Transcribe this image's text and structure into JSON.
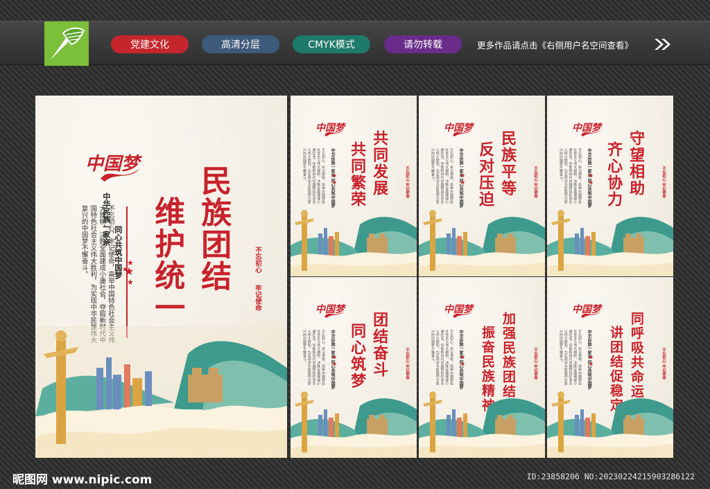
{
  "toolbar": {
    "tags": [
      {
        "label": "党建文化",
        "color": "#c5262d"
      },
      {
        "label": "高清分层",
        "color": "#3d5a7a"
      },
      {
        "label": "CMYK模式",
        "color": "#1f7a6c"
      },
      {
        "label": "请勿转载",
        "color": "#6a2c8a"
      }
    ],
    "note": "更多作品请点击《右侧用户名空间查看》",
    "logo_icon": "pen-nib-icon",
    "arrow_icon": "double-chevron-right-icon"
  },
  "main_board": {
    "brand": "中国梦",
    "title_line1": "民族团结",
    "title_line2": "维护统一",
    "subtitle_a": "中华民族一家亲",
    "subtitle_b": "同心共筑中国梦",
    "body_text": "不忘初心，牢记使命，高举中国特色社会主义伟大旗帜，决胜全面建成小康社会，夺取新时代中国特色社会主义伟大胜利，为实现中华民族伟大复兴的中国梦不懈奋斗。",
    "stamp_a": "不忘初心",
    "stamp_b": "牢记使命"
  },
  "small_boards": [
    {
      "title_a": "共同发展",
      "title_b": "共同繁荣"
    },
    {
      "title_a": "民族平等",
      "title_b": "反对压迫"
    },
    {
      "title_a": "守望相助",
      "title_b": "齐心协力"
    },
    {
      "title_a": "团结奋斗",
      "title_b": "同心筑梦"
    },
    {
      "title_a": "加强民族团结",
      "title_b": "振奋民族精神"
    },
    {
      "title_a": "同呼吸共命运",
      "title_b": "讲团结促稳定"
    }
  ],
  "small_common": {
    "brand": "中国梦",
    "subtitle": "中华民族一家亲 同心共筑中国梦",
    "stamp": "不忘初心 牢记使命"
  },
  "footer": {
    "site": "昵图网 www.nipic.com",
    "id_text": "ID:23858206 NO:20230224215903286122"
  },
  "colors": {
    "accent_red": "#c8232c",
    "paper": "#f3efe6",
    "gold": "#d9a441",
    "teal": "#3f9a8e"
  }
}
